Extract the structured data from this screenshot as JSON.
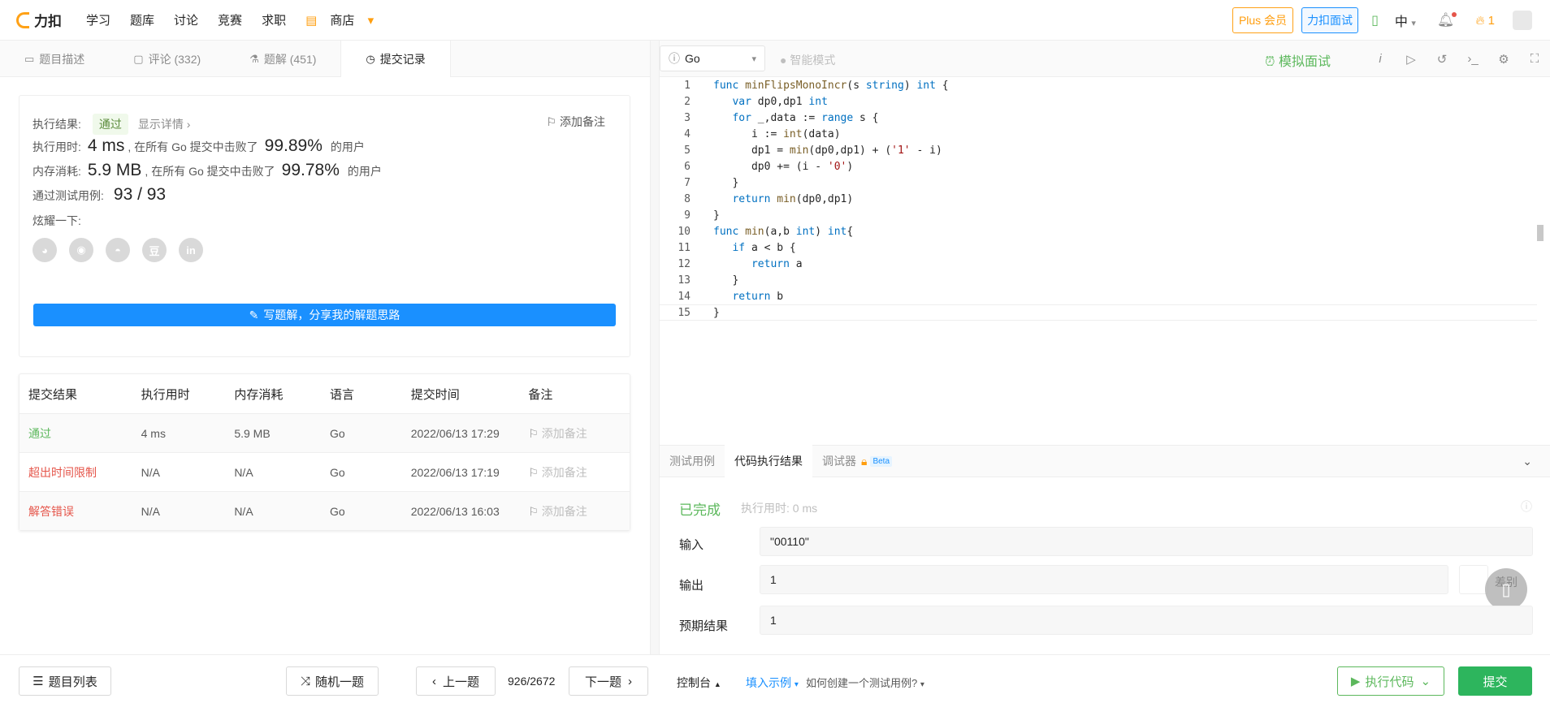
{
  "nav": {
    "logo": "力扣",
    "items": [
      "学习",
      "题库",
      "讨论",
      "竞赛",
      "求职"
    ],
    "shop": "商店"
  },
  "topright": {
    "plus": "Plus 会员",
    "interview": "力扣面试",
    "lang": "中",
    "streak": "1"
  },
  "tabs": {
    "desc": "题目描述",
    "comments": "评论 (332)",
    "solutions": "题解 (451)",
    "submissions": "提交记录"
  },
  "result": {
    "exec_label": "执行结果:",
    "status": "通过",
    "show_detail": "显示详情 ›",
    "add_note": "添加备注",
    "time_label": "执行用时:",
    "time_val": "4 ms",
    "time_mid": ", 在所有 Go 提交中击败了",
    "time_pct": "99.89%",
    "time_tail": "的用户",
    "mem_label": "内存消耗:",
    "mem_val": "5.9 MB",
    "mem_mid": ", 在所有 Go 提交中击败了",
    "mem_pct": "99.78%",
    "mem_tail": "的用户",
    "cases_label": "通过测试用例:",
    "cases_val": "93 / 93",
    "share_label": "炫耀一下:",
    "write_btn": "写题解，分享我的解题思路"
  },
  "submissions": {
    "headers": [
      "提交结果",
      "执行用时",
      "内存消耗",
      "语言",
      "提交时间",
      "备注"
    ],
    "rows": [
      {
        "result": "通过",
        "time": "4 ms",
        "mem": "5.9 MB",
        "lang": "Go",
        "date": "2022/06/13 17:29",
        "note": "添加备注"
      },
      {
        "result": "超出时间限制",
        "time": "N/A",
        "mem": "N/A",
        "lang": "Go",
        "date": "2022/06/13 17:19",
        "note": "添加备注"
      },
      {
        "result": "解答错误",
        "time": "N/A",
        "mem": "N/A",
        "lang": "Go",
        "date": "2022/06/13 16:03",
        "note": "添加备注"
      }
    ]
  },
  "editor": {
    "language": "Go",
    "smart_mode": "智能模式",
    "mock": "模拟面试"
  },
  "result_tabs": {
    "testcase": "测试用例",
    "code_result": "代码执行结果",
    "debugger": "调试器",
    "beta": "Beta"
  },
  "run_result": {
    "status": "已完成",
    "time": "执行用时: 0 ms",
    "input_label": "输入",
    "input": "\"00110\"",
    "output_label": "输出",
    "output": "1",
    "diff": "差别",
    "expected_label": "预期结果",
    "expected": "1"
  },
  "bottom": {
    "problem_list": "题目列表",
    "random": "随机一题",
    "prev": "上一题",
    "page": "926/2672",
    "next": "下一题",
    "console": "控制台",
    "fill_example": "填入示例",
    "how_to": "如何创建一个测试用例?",
    "run": "执行代码",
    "submit": "提交"
  }
}
